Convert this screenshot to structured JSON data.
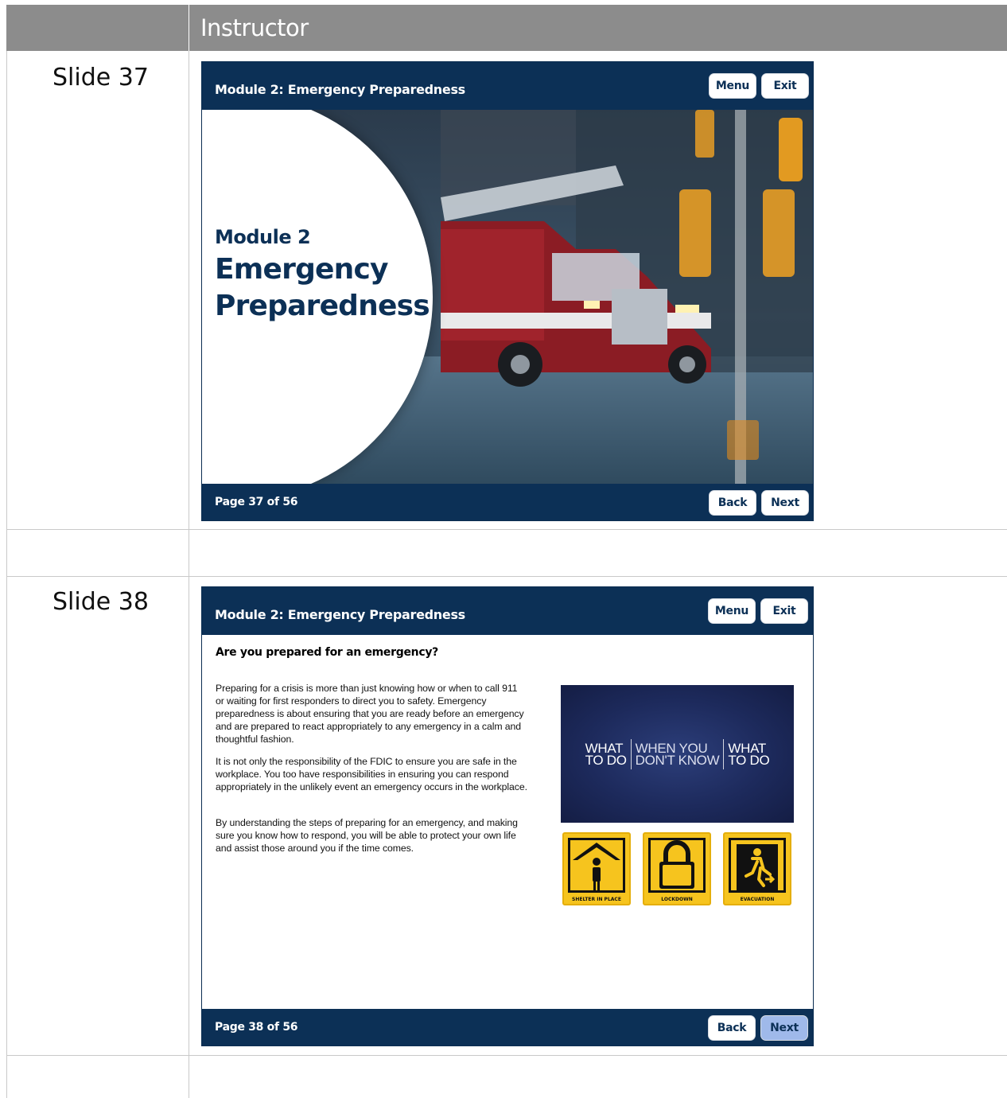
{
  "table": {
    "header": "Instructor",
    "rows": [
      {
        "label": "Slide 37"
      },
      {
        "label": "Slide 38"
      }
    ]
  },
  "slide37": {
    "module_title": "Module 2: Emergency Preparedness",
    "menu_label": "Menu",
    "exit_label": "Exit",
    "hero_line1": "Module 2",
    "hero_line2a": "Emergency",
    "hero_line2b": "Preparedness",
    "page_text": "Page 37 of 56",
    "back_label": "Back",
    "next_label": "Next",
    "image": "fire-truck-photo"
  },
  "slide38": {
    "module_title": "Module 2: Emergency Preparedness",
    "menu_label": "Menu",
    "exit_label": "Exit",
    "question": "Are you prepared for an emergency?",
    "paragraphs": [
      "Preparing for a crisis is more than just knowing how or when to call 911 or waiting for first responders to direct you to safety. Emergency preparedness is about ensuring that you are ready before an emergency and are prepared to react appropriately to any emergency in a calm and thoughtful fashion.",
      "It is not only the responsibility of the FDIC to ensure you are safe in the workplace. You too have responsibilities in ensuring you can respond appropriately in the unlikely event an emergency occurs in the workplace.",
      "By understanding the steps of preparing for an emergency, and making sure you know how to respond, you will be able to protect your own life and assist those around you if the time comes."
    ],
    "video": {
      "left_a": "WHAT",
      "left_b": "TO DO",
      "mid_a": "WHEN YOU",
      "mid_b": "DON'T KNOW",
      "right_a": "WHAT",
      "right_b": "TO DO"
    },
    "signs": [
      {
        "label": "SHELTER IN PLACE",
        "icon": "shelter-icon"
      },
      {
        "label": "LOCKDOWN",
        "icon": "lock-icon"
      },
      {
        "label": "EVACUATION",
        "icon": "exit-runner-icon"
      }
    ],
    "page_text": "Page 38 of 56",
    "back_label": "Back",
    "next_label": "Next"
  },
  "colors": {
    "navy": "#0c3056",
    "header_gray": "#8c8c8c",
    "sign_yellow": "#f6c41e",
    "next_active": "#9fb9ea"
  }
}
